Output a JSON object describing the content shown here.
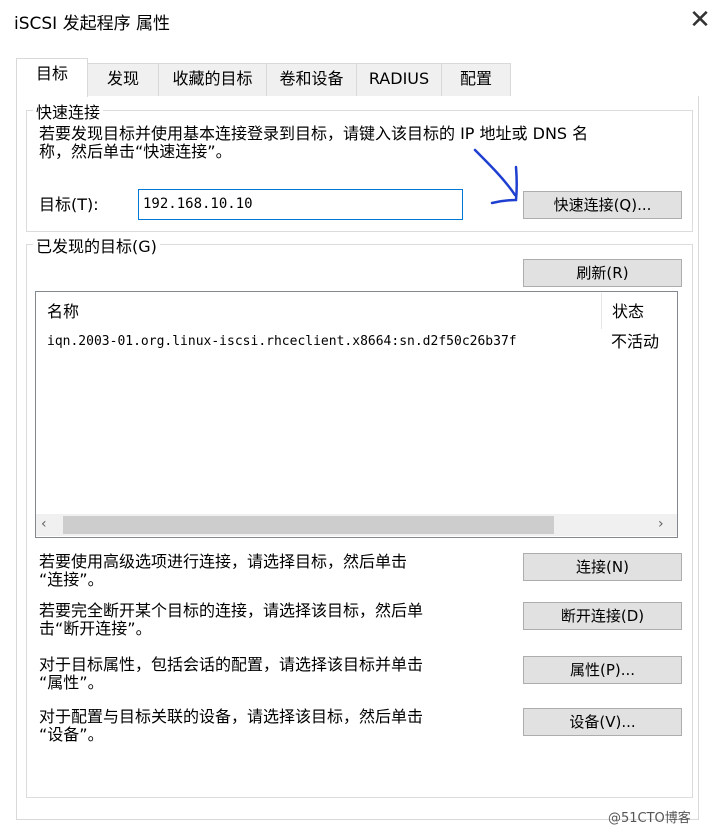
{
  "window": {
    "title": "iSCSI 发起程序 属性"
  },
  "tabs": [
    "目标",
    "发现",
    "收藏的目标",
    "卷和设备",
    "RADIUS",
    "配置"
  ],
  "quick_connect": {
    "legend": "快速连接",
    "desc_line1": "若要发现目标并使用基本连接登录到目标，请键入该目标的 IP 地址或 DNS 名",
    "desc_line2": "称，然后单击“快速连接”。",
    "target_label": "目标(T):",
    "target_value": "192.168.10.10",
    "button": "快速连接(Q)..."
  },
  "discovered": {
    "legend": "已发现的目标(G)",
    "refresh_button": "刷新(R)",
    "columns": [
      "名称",
      "状态"
    ],
    "rows": [
      {
        "name": "iqn.2003-01.org.linux-iscsi.rhceclient.x8664:sn.d2f50c26b37f",
        "status": "不活动"
      }
    ]
  },
  "actions": [
    {
      "line1": "若要使用高级选项进行连接，请选择目标，然后单击",
      "line2": "“连接”。",
      "button": "连接(N)"
    },
    {
      "line1": "若要完全断开某个目标的连接，请选择该目标，然后单",
      "line2": "击“断开连接”。",
      "button": "断开连接(D)"
    },
    {
      "line1": "对于目标属性，包括会话的配置，请选择该目标并单击",
      "line2": "“属性”。",
      "button": "属性(P)..."
    },
    {
      "line1": "对于配置与目标关联的设备，请选择该目标，然后单击",
      "line2": "“设备”。",
      "button": "设备(V)..."
    }
  ],
  "watermark": "@51CTO博客",
  "colors": {
    "focus_blue": "#0078d7",
    "annotation_blue": "#1f3fd0"
  }
}
